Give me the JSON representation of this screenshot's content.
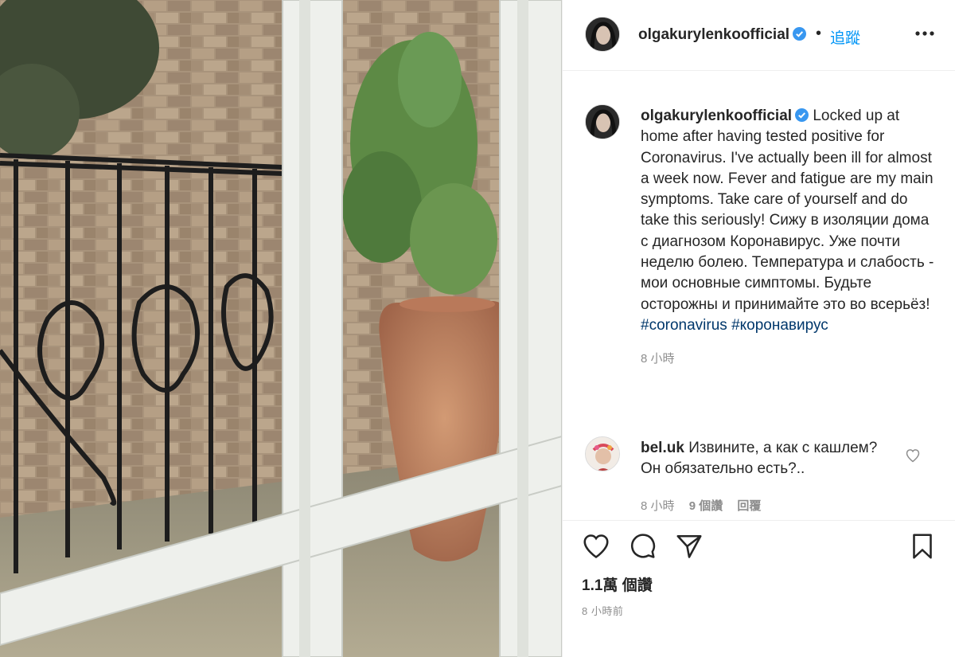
{
  "post": {
    "username": "olgakurylenkoofficial",
    "follow_label": "追蹤",
    "separator": "•",
    "caption": {
      "line_en": "Locked up at home after having tested positive for Coronavirus. I've actually been ill for almost a week now. Fever and fatigue are my main symptoms. Take care of yourself and do take this seriously!",
      "line_ru": "Сижу в изоляции дома с диагнозом Коронавирус. Уже почти неделю болею. Температура и слабость - мои основные симптомы. Будьте осторожны и принимайте это во всерьёз!",
      "hashtags": [
        "#coronavirus",
        "#коронавирус"
      ],
      "time": "8 小時"
    },
    "comment": {
      "username": "bel.uk",
      "text": "Извините, а как с кашлем? Он обязательно есть?..",
      "time": "8 小時",
      "likes": "9 個讚",
      "reply_label": "回覆"
    },
    "likes_label": "1.1萬 個讚",
    "timestamp": "8 小時前"
  },
  "icons": {
    "verified": "verified-badge-icon",
    "more": "more-options-icon",
    "like": "heart-icon",
    "comment": "comment-icon",
    "share": "share-icon",
    "save": "bookmark-icon"
  },
  "colors": {
    "link_blue": "#0095f6",
    "hashtag": "#00376b",
    "muted": "#8e8e8e",
    "text": "#262626"
  }
}
